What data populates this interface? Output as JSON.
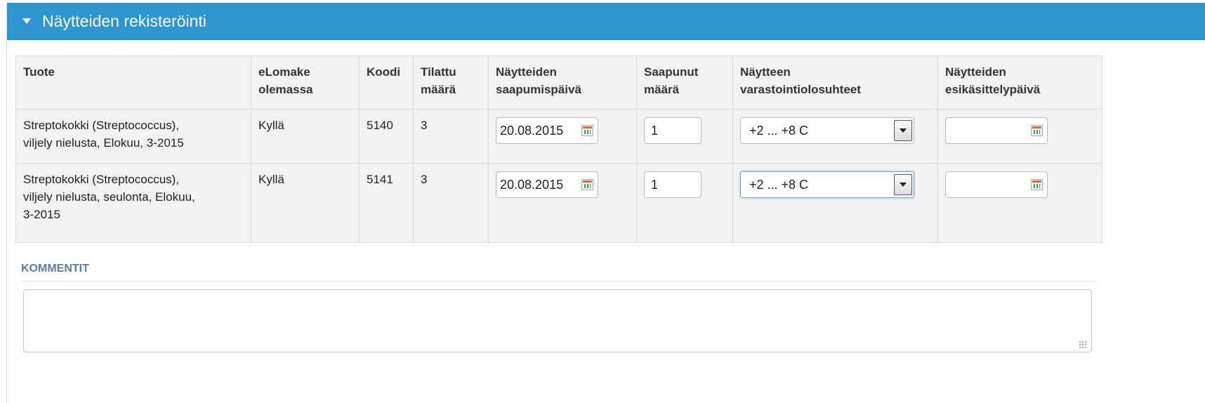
{
  "header": {
    "title": "Näytteiden rekisteröinti"
  },
  "table": {
    "columns": [
      [
        "Tuote"
      ],
      [
        "eLomake",
        "olemassa"
      ],
      [
        "Koodi"
      ],
      [
        "Tilattu",
        "määrä"
      ],
      [
        "Näytteiden",
        "saapumispäivä"
      ],
      [
        "Saapunut",
        "määrä"
      ],
      [
        "Näytteen",
        "varastointiolosuhteet"
      ],
      [
        "Näytteiden",
        "esikäsittelypäivä"
      ]
    ],
    "rows": [
      {
        "product": [
          "Streptokokki (Streptococcus),",
          "viljely nielusta, Elokuu, 3-2015"
        ],
        "elomake": "Kyllä",
        "code": "5140",
        "ordered": "3",
        "arrival_date": "20.08.2015",
        "arrived_qty": "1",
        "storage": "+2 ... +8 C",
        "pretreat_date": ""
      },
      {
        "product": [
          "Streptokokki (Streptococcus),",
          "viljely nielusta, seulonta, Elokuu,",
          "3-2015"
        ],
        "elomake": "Kyllä",
        "code": "5141",
        "ordered": "3",
        "arrival_date": "20.08.2015",
        "arrived_qty": "1",
        "storage": "+2 ... +8 C",
        "pretreat_date": ""
      }
    ]
  },
  "comments": {
    "label": "KOMMENTIT",
    "value": ""
  },
  "icons": {
    "collapse": "triangle-down-icon",
    "calendar": "calendar-icon",
    "select": "chevron-down-icon"
  }
}
